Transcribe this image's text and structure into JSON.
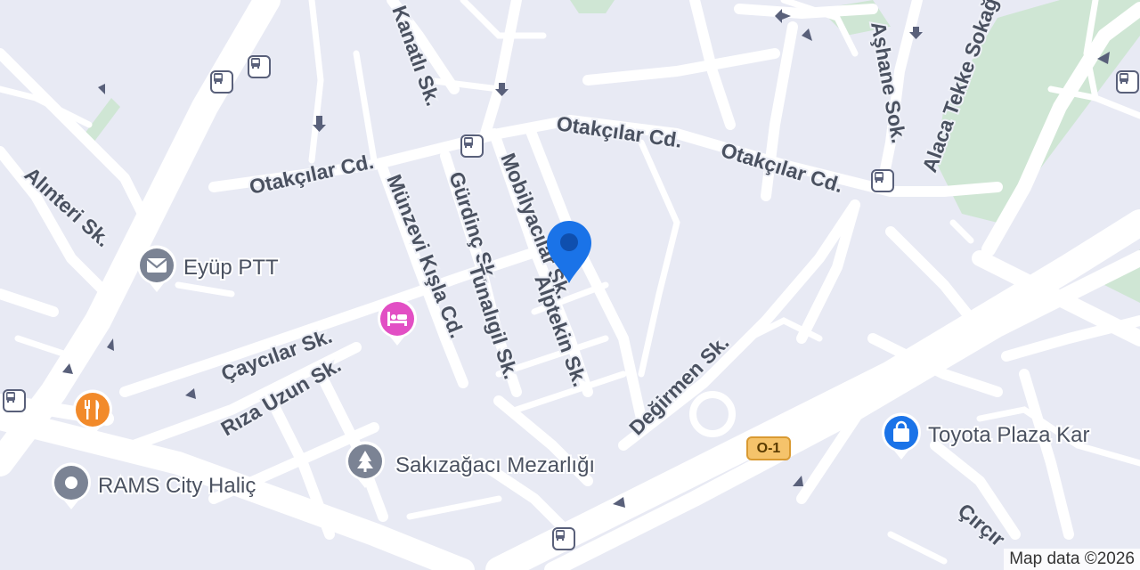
{
  "map": {
    "attribution": "Map data ©2026",
    "streets": {
      "kanatli": "Kanatlı Sk.",
      "otakcilar_1": "Otakçılar Cd.",
      "otakcilar_2": "Otakçılar Cd.",
      "otakcilar_3": "Otakçılar Cd.",
      "ashane": "Aşhane Sok.",
      "alaca_tekke": "Alaca Tekke Sokağı",
      "alinteri": "Alınteri Sk.",
      "munzevi": "Münzevi Kışla Cd.",
      "gurdinc": "Gürdinç Sk.",
      "mobilyacilar": "Mobilyacılar Sk.",
      "tunaligil": "Tunalıgil Sk.",
      "alptekin": "Alptekin Sk.",
      "caycilar": "Çaycılar Sk.",
      "riza_uzun": "Rıza Uzun Sk.",
      "degirmen": "Değirmen Sk.",
      "circir": "Çırçır"
    },
    "road_shield": "O-1",
    "pois": {
      "ptt": {
        "label": "Eyüp PTT",
        "icon": "mail-icon",
        "color": "#7b8394"
      },
      "rams": {
        "label": "RAMS City Haliç",
        "icon": "place-icon",
        "color": "#7b8394"
      },
      "mezarligi": {
        "label": "Sakızağacı Mezarlığı",
        "icon": "tree-icon",
        "color": "#7b8394"
      },
      "toyota": {
        "label": "Toyota Plaza Kar",
        "icon": "shopping-bag-icon",
        "color": "#1a73e8"
      },
      "hotel": {
        "icon": "hotel-icon",
        "color": "#e24fc4"
      },
      "restaurant": {
        "icon": "restaurant-icon",
        "color": "#f28a2a"
      }
    },
    "selected_pin_color": "#1a73e8",
    "park_color": "#cfe6d4",
    "road_color": "#ffffff",
    "land_color": "#e8eaf4"
  }
}
